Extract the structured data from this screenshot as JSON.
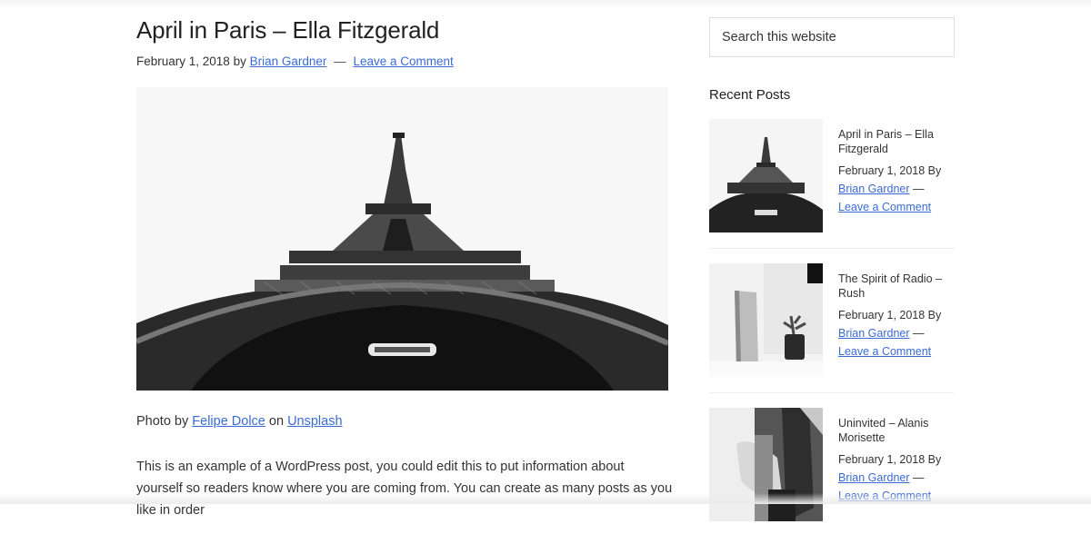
{
  "post": {
    "title": "April in Paris – Ella Fitzgerald",
    "date": "February 1, 2018",
    "by": "by",
    "author": "Brian Gardner",
    "separator": "—",
    "comment_link": "Leave a Comment",
    "image_alt": "Eiffel Tower viewed from below, black and white",
    "credit": {
      "prefix": "Photo by",
      "photographer": "Felipe Dolce",
      "on": "on",
      "source": "Unsplash"
    },
    "body": "This is an example of a WordPress post, you could edit this to put information about yourself so readers know where you are coming from. You can create as many posts as you like in order"
  },
  "sidebar": {
    "search_placeholder": "Search this website",
    "recent_title": "Recent Posts",
    "recent_posts": [
      {
        "title": "April in Paris – Ella Fitzgerald",
        "date": "February 1, 2018 By",
        "author": "Brian Gardner",
        "separator": "—",
        "comment": "Leave a Comment",
        "thumb": "eiffel-tower"
      },
      {
        "title": "The Spirit of Radio – Rush",
        "date": "February 1, 2018 By",
        "author": "Brian Gardner",
        "separator": "—",
        "comment": "Leave a Comment",
        "thumb": "speaker-plant"
      },
      {
        "title": "Uninvited – Alanis Morisette",
        "date": "February 1, 2018 By",
        "author": "Brian Gardner",
        "separator": "—",
        "comment": "Leave a Comment",
        "thumb": "guitarist"
      }
    ]
  },
  "colors": {
    "link": "#3b6bd4",
    "text": "#333333"
  }
}
